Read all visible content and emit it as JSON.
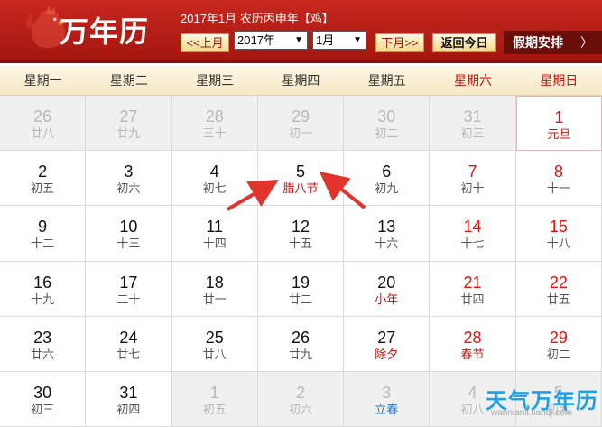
{
  "header": {
    "logo_text": "万年历",
    "date_info": "2017年1月 农历丙申年【鸡】",
    "prev_month": "<<上月",
    "next_month": "下月>>",
    "today": "返回今日",
    "year_value": "2017年",
    "month_value": "1月",
    "holiday": "假期安排"
  },
  "weekdays": [
    "星期一",
    "星期二",
    "星期三",
    "星期四",
    "星期五",
    "星期六",
    "星期日"
  ],
  "cells": [
    {
      "solar": "26",
      "lunar": "廿八"
    },
    {
      "solar": "27",
      "lunar": "廿九"
    },
    {
      "solar": "28",
      "lunar": "三十"
    },
    {
      "solar": "29",
      "lunar": "初一"
    },
    {
      "solar": "30",
      "lunar": "初二"
    },
    {
      "solar": "31",
      "lunar": "初三"
    },
    {
      "solar": "1",
      "lunar": "元旦"
    },
    {
      "solar": "2",
      "lunar": "初五"
    },
    {
      "solar": "3",
      "lunar": "初六"
    },
    {
      "solar": "4",
      "lunar": "初七"
    },
    {
      "solar": "5",
      "lunar": "腊八节"
    },
    {
      "solar": "6",
      "lunar": "初九"
    },
    {
      "solar": "7",
      "lunar": "初十"
    },
    {
      "solar": "8",
      "lunar": "十一"
    },
    {
      "solar": "9",
      "lunar": "十二"
    },
    {
      "solar": "10",
      "lunar": "十三"
    },
    {
      "solar": "11",
      "lunar": "十四"
    },
    {
      "solar": "12",
      "lunar": "十五"
    },
    {
      "solar": "13",
      "lunar": "十六"
    },
    {
      "solar": "14",
      "lunar": "十七"
    },
    {
      "solar": "15",
      "lunar": "十八"
    },
    {
      "solar": "16",
      "lunar": "十九"
    },
    {
      "solar": "17",
      "lunar": "二十"
    },
    {
      "solar": "18",
      "lunar": "廿一"
    },
    {
      "solar": "19",
      "lunar": "廿二"
    },
    {
      "solar": "20",
      "lunar": "小年"
    },
    {
      "solar": "21",
      "lunar": "廿四"
    },
    {
      "solar": "22",
      "lunar": "廿五"
    },
    {
      "solar": "23",
      "lunar": "廿六"
    },
    {
      "solar": "24",
      "lunar": "廿七"
    },
    {
      "solar": "25",
      "lunar": "廿八"
    },
    {
      "solar": "26",
      "lunar": "廿九"
    },
    {
      "solar": "27",
      "lunar": "除夕"
    },
    {
      "solar": "28",
      "lunar": "春节"
    },
    {
      "solar": "29",
      "lunar": "初二"
    },
    {
      "solar": "30",
      "lunar": "初三"
    },
    {
      "solar": "31",
      "lunar": "初四"
    },
    {
      "solar": "1",
      "lunar": "初五"
    },
    {
      "solar": "2",
      "lunar": "初六"
    },
    {
      "solar": "3",
      "lunar": "立春"
    },
    {
      "solar": "4",
      "lunar": "初八"
    },
    {
      "solar": "5",
      "lunar": "初九"
    }
  ],
  "watermark": {
    "title": "天气万年历",
    "url": "wannianli.tianqi.com"
  },
  "colors": {
    "header_red": "#b81d14",
    "holiday_red": "#c4150f",
    "term_blue": "#2b78c2",
    "watermark_blue": "#1ea0e6"
  }
}
